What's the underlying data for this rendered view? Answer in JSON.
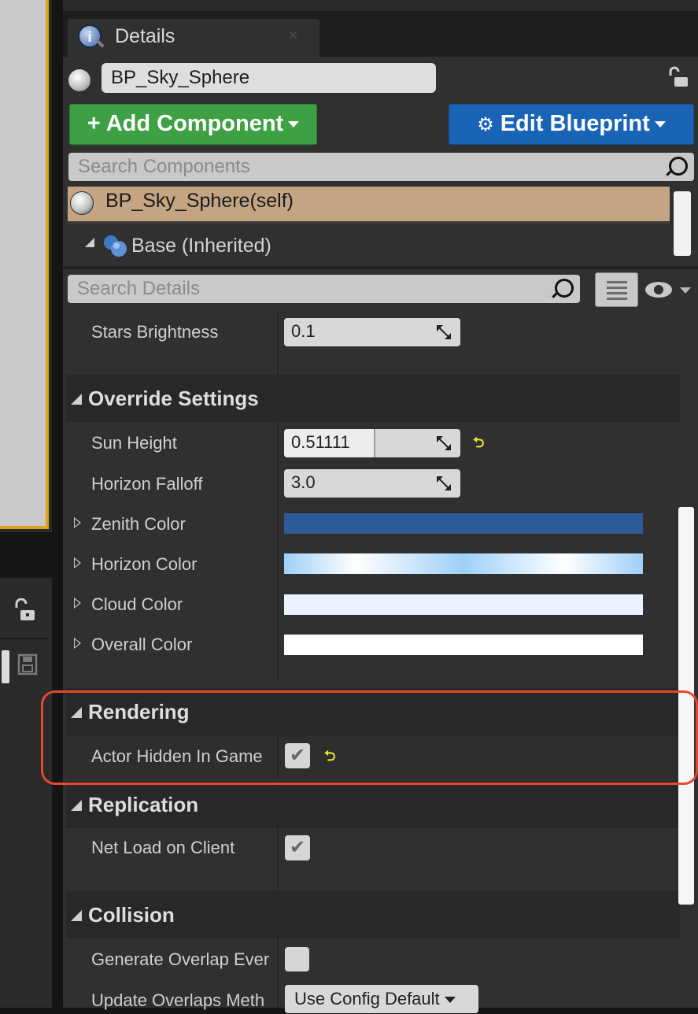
{
  "tab": {
    "label": "Details",
    "close": "×"
  },
  "actor": {
    "name": "BP_Sky_Sphere"
  },
  "toolbar": {
    "add_component": "+ Add Component",
    "edit_blueprint": "Edit Blueprint"
  },
  "components": {
    "search_placeholder": "Search Components",
    "items": [
      {
        "label": "BP_Sky_Sphere(self)"
      },
      {
        "label": "Base (Inherited)"
      }
    ]
  },
  "details_search": {
    "placeholder": "Search Details"
  },
  "properties": {
    "stars_brightness": {
      "label": "Stars Brightness",
      "value": "0.1"
    },
    "override_section": "Override Settings",
    "sun_height": {
      "label": "Sun Height",
      "value": "0.51111",
      "slider_fraction": 0.51111
    },
    "horizon_falloff": {
      "label": "Horizon Falloff",
      "value": "3.0"
    },
    "zenith_color": {
      "label": "Zenith Color",
      "color": "#2f5a9a"
    },
    "horizon_color": {
      "label": "Horizon Color",
      "color": "#9fd0f8"
    },
    "cloud_color": {
      "label": "Cloud Color",
      "color": "#eaf3ff"
    },
    "overall_color": {
      "label": "Overall Color",
      "color": "#ffffff"
    },
    "rendering_section": "Rendering",
    "actor_hidden": {
      "label": "Actor Hidden In Game",
      "checked": true
    },
    "replication_section": "Replication",
    "net_load": {
      "label": "Net Load on Client",
      "checked": true
    },
    "collision_section": "Collision",
    "generate_overlap": {
      "label": "Generate Overlap Ever",
      "checked": false
    },
    "update_overlaps": {
      "label": "Update Overlaps Meth",
      "value": "Use Config Default"
    }
  },
  "reset_glyph": "⮌",
  "check_glyph": "✔"
}
